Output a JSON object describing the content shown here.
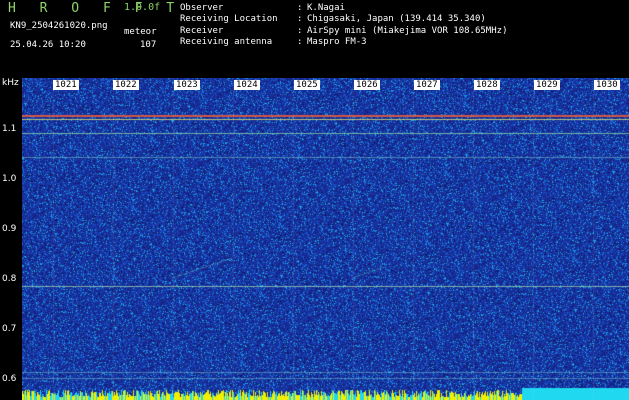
{
  "header": {
    "brand": "H R O F F T",
    "version": "1.0.0f",
    "filename": "KN9_2504261020.png",
    "meteor_label": "meteor",
    "datetime": "25.04.26 10:20",
    "meteor_count": "107"
  },
  "info": [
    {
      "label": "Observer",
      "value": "K.Nagai"
    },
    {
      "label": "Receiving Location",
      "value": "Chigasaki, Japan (139.414 35.340)"
    },
    {
      "label": "Receiver",
      "value": "AirSpy mini (Miakejima VOR 108.65MHz)"
    },
    {
      "label": "Receiving antenna",
      "value": "Maspro FM-3"
    }
  ],
  "axis": {
    "unit": "kHz",
    "ticks": [
      "1.1",
      "1.0",
      "0.9",
      "0.8",
      "0.7",
      "0.6"
    ]
  },
  "minutes": [
    "1021",
    "1022",
    "1023",
    "1024",
    "1025",
    "1026",
    "1027",
    "1028",
    "1029",
    "1030"
  ]
}
